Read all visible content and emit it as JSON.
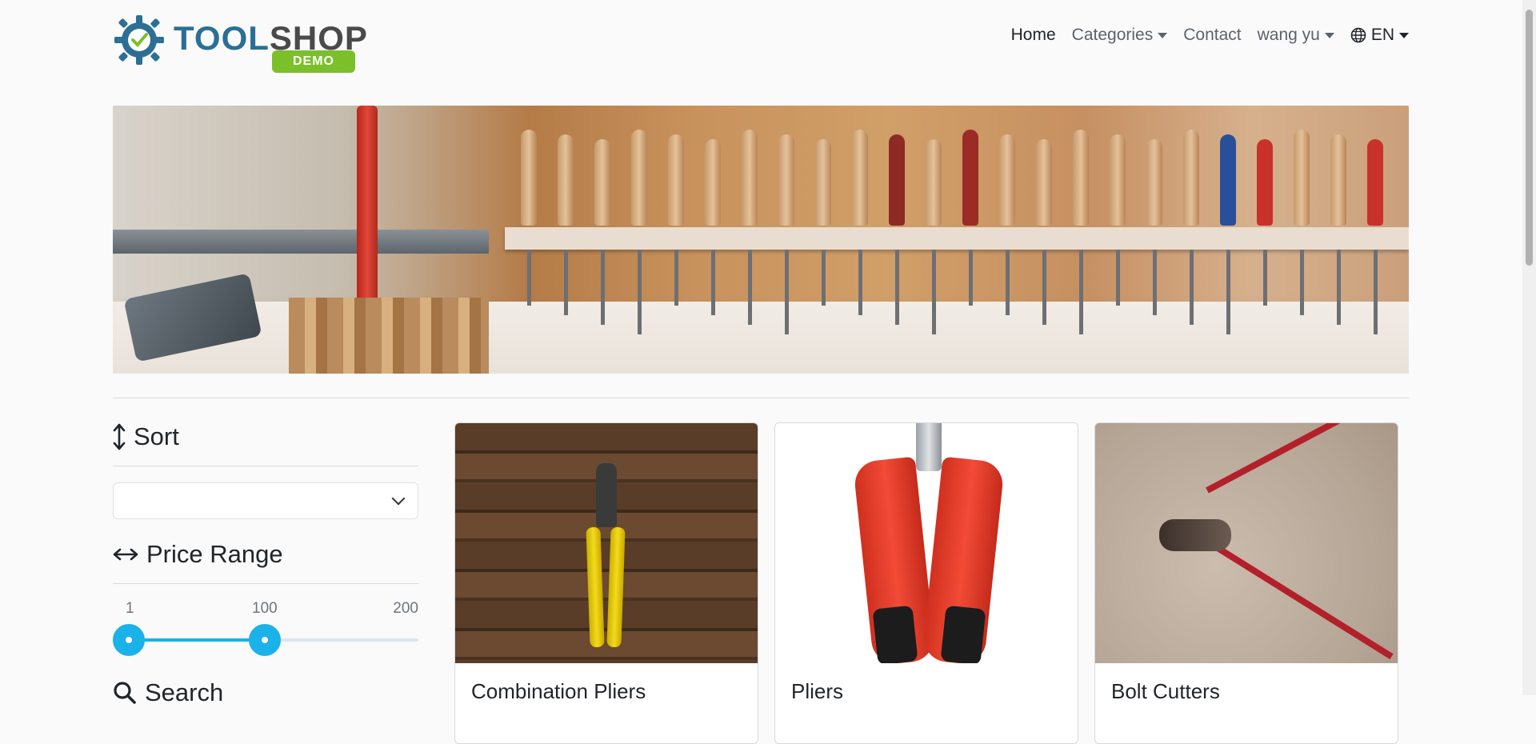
{
  "brand": {
    "name_part1": "TOOL",
    "name_part2": "SHOP",
    "badge": "DEMO"
  },
  "nav": {
    "items": [
      {
        "label": "Home",
        "active": true,
        "dropdown": false
      },
      {
        "label": "Categories",
        "active": false,
        "dropdown": true
      },
      {
        "label": "Contact",
        "active": false,
        "dropdown": false
      },
      {
        "label": "wang yu",
        "active": false,
        "dropdown": true
      },
      {
        "label": "EN",
        "active": false,
        "dropdown": true,
        "icon": "globe-icon"
      }
    ]
  },
  "sidebar": {
    "sort": {
      "title": "Sort",
      "icon": "sort-arrows-icon",
      "selected": ""
    },
    "price_range": {
      "title": "Price Range",
      "icon": "horizontal-arrows-icon",
      "min_label": "1",
      "current_label": "100",
      "max_label": "200",
      "min": 1,
      "max": 200,
      "low": 1,
      "high": 100
    },
    "search": {
      "title": "Search",
      "icon": "magnifier-icon"
    }
  },
  "products": [
    {
      "name": "Combination Pliers",
      "image": "pliers-on-wood"
    },
    {
      "name": "Pliers",
      "image": "red-pliers"
    },
    {
      "name": "Bolt Cutters",
      "image": "red-bolt-cutters"
    }
  ],
  "colors": {
    "accent": "#1ab2e8",
    "brand_blue": "#2b6f95",
    "badge_green": "#7bbf2a"
  }
}
